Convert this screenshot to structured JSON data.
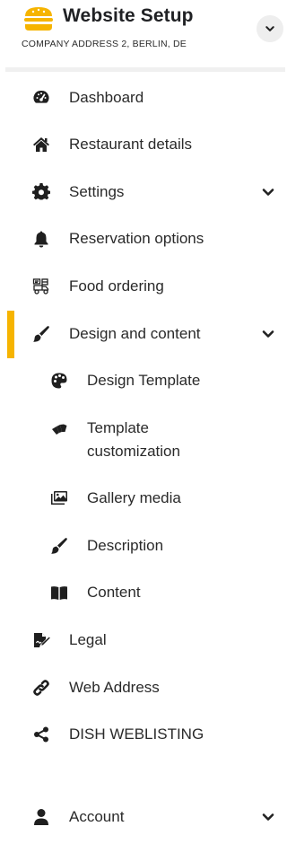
{
  "header": {
    "title": "Website Setup",
    "subtitle": "COMPANY ADDRESS 2, BERLIN, DE",
    "logo_icon": "burger-icon",
    "toggle_icon": "chevron-down-icon"
  },
  "colors": {
    "accent": "#f6b400",
    "text": "#2a2a2a"
  },
  "menu": {
    "dashboard": {
      "label": "Dashboard",
      "icon": "speedometer-icon"
    },
    "restaurant_details": {
      "label": "Restaurant details",
      "icon": "home-icon"
    },
    "settings": {
      "label": "Settings",
      "icon": "gear-icon"
    },
    "reservation_options": {
      "label": "Reservation options",
      "icon": "bell-icon"
    },
    "food_ordering": {
      "label": "Food ordering",
      "icon": "food-delivery-icon"
    },
    "design_and_content": {
      "label": "Design and content",
      "icon": "paintbrush-icon",
      "active": true
    },
    "design_template": {
      "label": "Design Template",
      "icon": "palette-icon"
    },
    "template_customization": {
      "label_line1": "Template",
      "label_line2": "customization",
      "icon": "swatchbook-icon"
    },
    "gallery_media": {
      "label": "Gallery media",
      "icon": "images-icon"
    },
    "description": {
      "label": "Description",
      "icon": "paintbrush-icon"
    },
    "content": {
      "label": "Content",
      "icon": "book-icon"
    },
    "legal": {
      "label": "Legal",
      "icon": "signature-icon"
    },
    "web_address": {
      "label": "Web Address",
      "icon": "link-icon"
    },
    "dish_weblisting": {
      "label": "DISH WEBLISTING",
      "icon": "share-icon"
    },
    "account": {
      "label": "Account",
      "icon": "user-icon"
    }
  }
}
